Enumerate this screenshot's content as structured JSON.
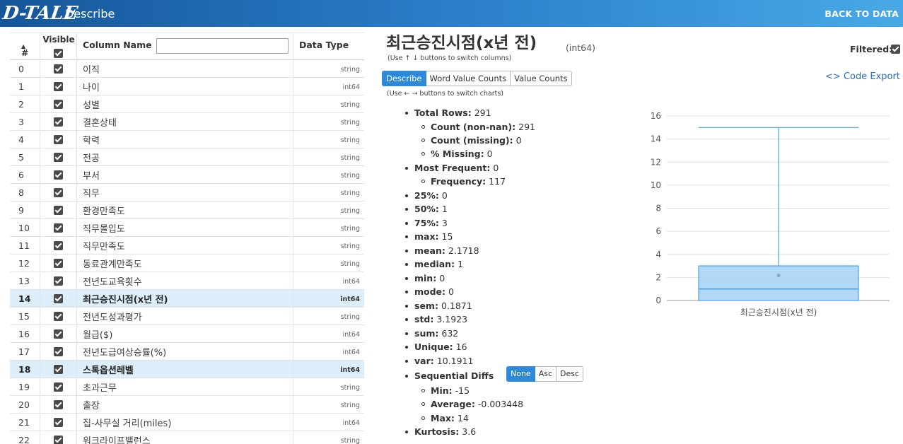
{
  "header": {
    "logo": "D-TALE",
    "title": "Describe",
    "back_label": "BACK TO DATA"
  },
  "table": {
    "headers": {
      "num": "#",
      "sort_icon": "triangle-up-icon",
      "visible": "Visible",
      "name": "Column Name",
      "search_placeholder": "",
      "dtype": "Data Type"
    },
    "rows": [
      {
        "idx": "0",
        "name": "이직",
        "dtype": "string"
      },
      {
        "idx": "1",
        "name": "나이",
        "dtype": "int64"
      },
      {
        "idx": "2",
        "name": "성별",
        "dtype": "string"
      },
      {
        "idx": "3",
        "name": "결혼상태",
        "dtype": "string"
      },
      {
        "idx": "4",
        "name": "학력",
        "dtype": "string"
      },
      {
        "idx": "5",
        "name": "전공",
        "dtype": "string"
      },
      {
        "idx": "6",
        "name": "부서",
        "dtype": "string"
      },
      {
        "idx": "8",
        "name": "직무",
        "dtype": "string"
      },
      {
        "idx": "9",
        "name": "환경만족도",
        "dtype": "string"
      },
      {
        "idx": "10",
        "name": "직무몰입도",
        "dtype": "string"
      },
      {
        "idx": "11",
        "name": "직무만족도",
        "dtype": "string"
      },
      {
        "idx": "12",
        "name": "동료관계만족도",
        "dtype": "string"
      },
      {
        "idx": "13",
        "name": "전년도교육횟수",
        "dtype": "int64"
      },
      {
        "idx": "14",
        "name": "최근승진시점(x년 전)",
        "dtype": "int64",
        "selected": true
      },
      {
        "idx": "15",
        "name": "전년도성과평가",
        "dtype": "string"
      },
      {
        "idx": "16",
        "name": "월급($)",
        "dtype": "int64"
      },
      {
        "idx": "17",
        "name": "전년도급여상승률(%)",
        "dtype": "int64"
      },
      {
        "idx": "18",
        "name": "스톡옵션레벨",
        "dtype": "int64",
        "selected": true
      },
      {
        "idx": "19",
        "name": "초과근무",
        "dtype": "string"
      },
      {
        "idx": "20",
        "name": "출장",
        "dtype": "string"
      },
      {
        "idx": "21",
        "name": "집-사무실 거리(miles)",
        "dtype": "int64"
      },
      {
        "idx": "22",
        "name": "워크라이프밸런스",
        "dtype": "string"
      }
    ]
  },
  "detail": {
    "title": "최근승진시점(x년 전)",
    "dtype": "(int64)",
    "hint_columns": "(Use ↑ ↓ buttons to switch columns)",
    "filtered_label": "Filtered:",
    "tabs": [
      "Describe",
      "Word Value Counts",
      "Value Counts"
    ],
    "active_tab": "Describe",
    "hint_charts": "(Use ← → buttons to switch charts)",
    "code_export": "Code Export",
    "stats": [
      {
        "label": "Total Rows:",
        "value": "291",
        "level": 1
      },
      {
        "label": "Count (non-nan):",
        "value": "291",
        "level": 2
      },
      {
        "label": "Count (missing):",
        "value": "0",
        "level": 2
      },
      {
        "label": "% Missing:",
        "value": "0",
        "level": 2
      },
      {
        "label": "Most Frequent:",
        "value": "0",
        "level": 1
      },
      {
        "label": "Frequency:",
        "value": "117",
        "level": 2
      },
      {
        "label": "25%:",
        "value": "0",
        "level": 1
      },
      {
        "label": "50%:",
        "value": "1",
        "level": 1
      },
      {
        "label": "75%:",
        "value": "3",
        "level": 1
      },
      {
        "label": "max:",
        "value": "15",
        "level": 1
      },
      {
        "label": "mean:",
        "value": "2.1718",
        "level": 1
      },
      {
        "label": "median:",
        "value": "1",
        "level": 1
      },
      {
        "label": "min:",
        "value": "0",
        "level": 1
      },
      {
        "label": "mode:",
        "value": "0",
        "level": 1
      },
      {
        "label": "sem:",
        "value": "0.1871",
        "level": 1
      },
      {
        "label": "std:",
        "value": "3.1923",
        "level": 1
      },
      {
        "label": "sum:",
        "value": "632",
        "level": 1
      },
      {
        "label": "Unique:",
        "value": "16",
        "level": 1
      },
      {
        "label": "var:",
        "value": "10.1911",
        "level": 1
      },
      {
        "label": "Sequential Diffs",
        "value": "",
        "level": 1,
        "buttons": [
          "None",
          "Asc",
          "Desc"
        ],
        "active_button": "None"
      },
      {
        "label": "Min:",
        "value": "-15",
        "level": 2
      },
      {
        "label": "Average:",
        "value": "-0.003448",
        "level": 2
      },
      {
        "label": "Max:",
        "value": "14",
        "level": 2
      },
      {
        "label": "Kurtosis:",
        "value": "3.6",
        "level": 1
      }
    ]
  },
  "chart_data": {
    "type": "box",
    "categories": [
      "최근승진시점(x년 전)"
    ],
    "min": 0,
    "q1": 0,
    "median": 1,
    "q3": 3,
    "max": 15,
    "mean": 2.1718,
    "ylim": [
      0,
      16
    ],
    "yticks": [
      0,
      2,
      4,
      6,
      8,
      10,
      12,
      14,
      16
    ],
    "grid": true,
    "colors": {
      "box_fill": "#a8d4f5",
      "box_stroke": "#4aa3e0",
      "grid": "#e0e0e0"
    }
  }
}
